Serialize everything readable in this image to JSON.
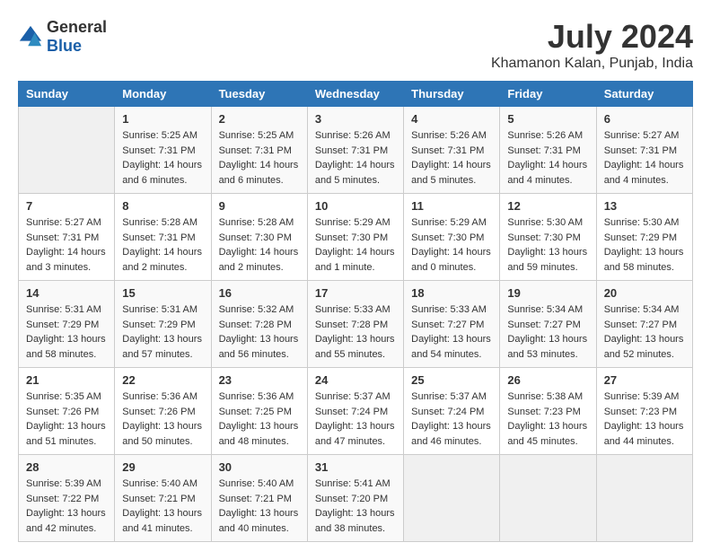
{
  "logo": {
    "general": "General",
    "blue": "Blue"
  },
  "title": "July 2024",
  "location": "Khamanon Kalan, Punjab, India",
  "days_of_week": [
    "Sunday",
    "Monday",
    "Tuesday",
    "Wednesday",
    "Thursday",
    "Friday",
    "Saturday"
  ],
  "weeks": [
    [
      {
        "day": "",
        "sunrise": "",
        "sunset": "",
        "daylight": ""
      },
      {
        "day": "1",
        "sunrise": "Sunrise: 5:25 AM",
        "sunset": "Sunset: 7:31 PM",
        "daylight": "Daylight: 14 hours and 6 minutes."
      },
      {
        "day": "2",
        "sunrise": "Sunrise: 5:25 AM",
        "sunset": "Sunset: 7:31 PM",
        "daylight": "Daylight: 14 hours and 6 minutes."
      },
      {
        "day": "3",
        "sunrise": "Sunrise: 5:26 AM",
        "sunset": "Sunset: 7:31 PM",
        "daylight": "Daylight: 14 hours and 5 minutes."
      },
      {
        "day": "4",
        "sunrise": "Sunrise: 5:26 AM",
        "sunset": "Sunset: 7:31 PM",
        "daylight": "Daylight: 14 hours and 5 minutes."
      },
      {
        "day": "5",
        "sunrise": "Sunrise: 5:26 AM",
        "sunset": "Sunset: 7:31 PM",
        "daylight": "Daylight: 14 hours and 4 minutes."
      },
      {
        "day": "6",
        "sunrise": "Sunrise: 5:27 AM",
        "sunset": "Sunset: 7:31 PM",
        "daylight": "Daylight: 14 hours and 4 minutes."
      }
    ],
    [
      {
        "day": "7",
        "sunrise": "Sunrise: 5:27 AM",
        "sunset": "Sunset: 7:31 PM",
        "daylight": "Daylight: 14 hours and 3 minutes."
      },
      {
        "day": "8",
        "sunrise": "Sunrise: 5:28 AM",
        "sunset": "Sunset: 7:31 PM",
        "daylight": "Daylight: 14 hours and 2 minutes."
      },
      {
        "day": "9",
        "sunrise": "Sunrise: 5:28 AM",
        "sunset": "Sunset: 7:30 PM",
        "daylight": "Daylight: 14 hours and 2 minutes."
      },
      {
        "day": "10",
        "sunrise": "Sunrise: 5:29 AM",
        "sunset": "Sunset: 7:30 PM",
        "daylight": "Daylight: 14 hours and 1 minute."
      },
      {
        "day": "11",
        "sunrise": "Sunrise: 5:29 AM",
        "sunset": "Sunset: 7:30 PM",
        "daylight": "Daylight: 14 hours and 0 minutes."
      },
      {
        "day": "12",
        "sunrise": "Sunrise: 5:30 AM",
        "sunset": "Sunset: 7:30 PM",
        "daylight": "Daylight: 13 hours and 59 minutes."
      },
      {
        "day": "13",
        "sunrise": "Sunrise: 5:30 AM",
        "sunset": "Sunset: 7:29 PM",
        "daylight": "Daylight: 13 hours and 58 minutes."
      }
    ],
    [
      {
        "day": "14",
        "sunrise": "Sunrise: 5:31 AM",
        "sunset": "Sunset: 7:29 PM",
        "daylight": "Daylight: 13 hours and 58 minutes."
      },
      {
        "day": "15",
        "sunrise": "Sunrise: 5:31 AM",
        "sunset": "Sunset: 7:29 PM",
        "daylight": "Daylight: 13 hours and 57 minutes."
      },
      {
        "day": "16",
        "sunrise": "Sunrise: 5:32 AM",
        "sunset": "Sunset: 7:28 PM",
        "daylight": "Daylight: 13 hours and 56 minutes."
      },
      {
        "day": "17",
        "sunrise": "Sunrise: 5:33 AM",
        "sunset": "Sunset: 7:28 PM",
        "daylight": "Daylight: 13 hours and 55 minutes."
      },
      {
        "day": "18",
        "sunrise": "Sunrise: 5:33 AM",
        "sunset": "Sunset: 7:27 PM",
        "daylight": "Daylight: 13 hours and 54 minutes."
      },
      {
        "day": "19",
        "sunrise": "Sunrise: 5:34 AM",
        "sunset": "Sunset: 7:27 PM",
        "daylight": "Daylight: 13 hours and 53 minutes."
      },
      {
        "day": "20",
        "sunrise": "Sunrise: 5:34 AM",
        "sunset": "Sunset: 7:27 PM",
        "daylight": "Daylight: 13 hours and 52 minutes."
      }
    ],
    [
      {
        "day": "21",
        "sunrise": "Sunrise: 5:35 AM",
        "sunset": "Sunset: 7:26 PM",
        "daylight": "Daylight: 13 hours and 51 minutes."
      },
      {
        "day": "22",
        "sunrise": "Sunrise: 5:36 AM",
        "sunset": "Sunset: 7:26 PM",
        "daylight": "Daylight: 13 hours and 50 minutes."
      },
      {
        "day": "23",
        "sunrise": "Sunrise: 5:36 AM",
        "sunset": "Sunset: 7:25 PM",
        "daylight": "Daylight: 13 hours and 48 minutes."
      },
      {
        "day": "24",
        "sunrise": "Sunrise: 5:37 AM",
        "sunset": "Sunset: 7:24 PM",
        "daylight": "Daylight: 13 hours and 47 minutes."
      },
      {
        "day": "25",
        "sunrise": "Sunrise: 5:37 AM",
        "sunset": "Sunset: 7:24 PM",
        "daylight": "Daylight: 13 hours and 46 minutes."
      },
      {
        "day": "26",
        "sunrise": "Sunrise: 5:38 AM",
        "sunset": "Sunset: 7:23 PM",
        "daylight": "Daylight: 13 hours and 45 minutes."
      },
      {
        "day": "27",
        "sunrise": "Sunrise: 5:39 AM",
        "sunset": "Sunset: 7:23 PM",
        "daylight": "Daylight: 13 hours and 44 minutes."
      }
    ],
    [
      {
        "day": "28",
        "sunrise": "Sunrise: 5:39 AM",
        "sunset": "Sunset: 7:22 PM",
        "daylight": "Daylight: 13 hours and 42 minutes."
      },
      {
        "day": "29",
        "sunrise": "Sunrise: 5:40 AM",
        "sunset": "Sunset: 7:21 PM",
        "daylight": "Daylight: 13 hours and 41 minutes."
      },
      {
        "day": "30",
        "sunrise": "Sunrise: 5:40 AM",
        "sunset": "Sunset: 7:21 PM",
        "daylight": "Daylight: 13 hours and 40 minutes."
      },
      {
        "day": "31",
        "sunrise": "Sunrise: 5:41 AM",
        "sunset": "Sunset: 7:20 PM",
        "daylight": "Daylight: 13 hours and 38 minutes."
      },
      {
        "day": "",
        "sunrise": "",
        "sunset": "",
        "daylight": ""
      },
      {
        "day": "",
        "sunrise": "",
        "sunset": "",
        "daylight": ""
      },
      {
        "day": "",
        "sunrise": "",
        "sunset": "",
        "daylight": ""
      }
    ]
  ]
}
